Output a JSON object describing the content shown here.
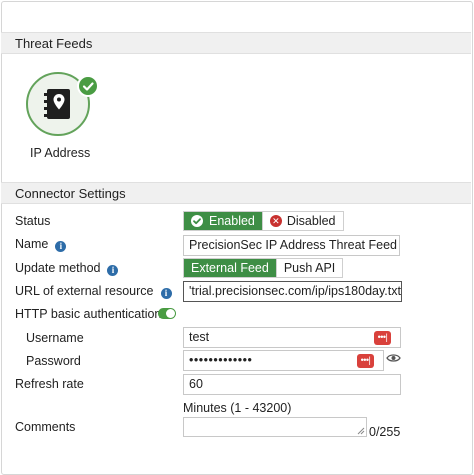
{
  "threat_feeds": {
    "section_title": "Threat Feeds",
    "card": {
      "label": "IP Address",
      "icon": "address-book-icon",
      "status_icon": "check-icon"
    }
  },
  "connector_settings": {
    "section_title": "Connector Settings",
    "status": {
      "label": "Status",
      "options": [
        "Enabled",
        "Disabled"
      ],
      "selected": "Enabled"
    },
    "name": {
      "label": "Name",
      "value": "PrecisionSec IP Address Threat Feed"
    },
    "update_method": {
      "label": "Update method",
      "options": [
        "External Feed",
        "Push API"
      ],
      "selected": "External Feed"
    },
    "url": {
      "label": "URL of external resource",
      "value": "'trial.precisionsec.com/ip/ips180day.txt"
    },
    "http_auth": {
      "label": "HTTP basic authentication",
      "enabled": true
    },
    "username": {
      "label": "Username",
      "value": "test",
      "key_button": "•••|"
    },
    "password": {
      "label": "Password",
      "value": "•••••••••••••",
      "key_button": "•••|",
      "reveal_icon": "eye-icon"
    },
    "refresh_rate": {
      "label": "Refresh rate",
      "value": "60",
      "hint": "Minutes (1 - 43200)"
    },
    "comments": {
      "label": "Comments",
      "value": "",
      "counter": "0/255"
    }
  },
  "colors": {
    "accent_green": "#3e8e45",
    "info_blue": "#2d6ca8",
    "danger_red": "#d9413c"
  }
}
